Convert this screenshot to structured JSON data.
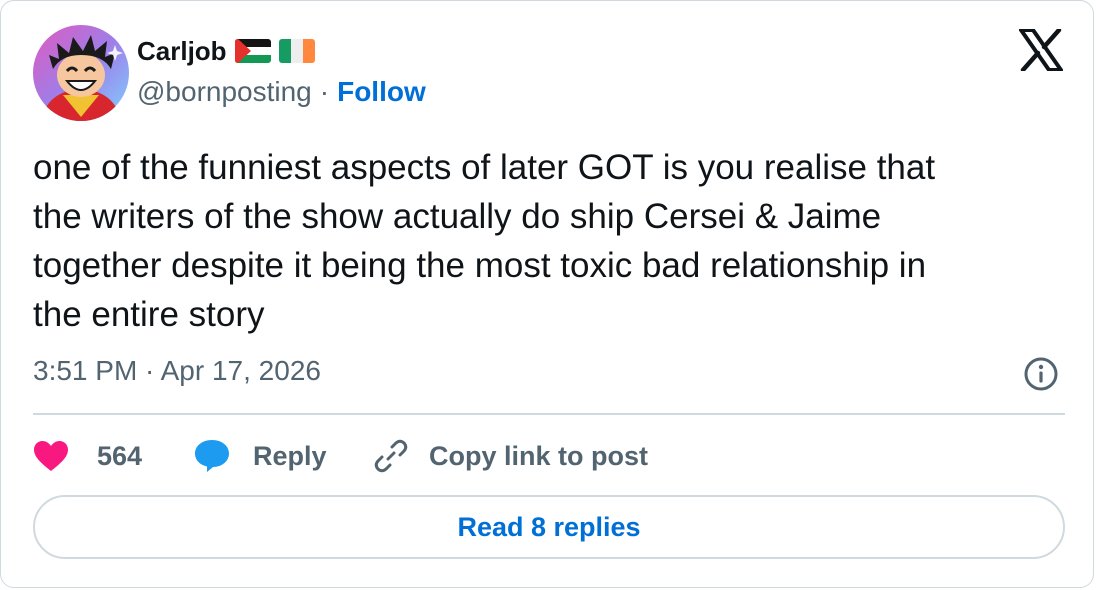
{
  "author": {
    "display_name": "Carljob",
    "handle": "@bornposting",
    "separator": "·",
    "follow_label": "Follow",
    "flags": [
      "palestine-flag",
      "ireland-flag"
    ]
  },
  "tweet": {
    "lines": [
      "one of the funniest aspects of later GOT is you realise that",
      "the writers of the show actually do ship Cersei & Jaime",
      "together despite it being the most toxic bad relationship in",
      "the entire story"
    ],
    "timestamp": "3:51 PM · Apr 17, 2026"
  },
  "actions": {
    "like_count": "564",
    "reply_label": "Reply",
    "copy_link_label": "Copy link to post"
  },
  "footer": {
    "read_replies_label": "Read 8 replies"
  },
  "colors": {
    "text": "#0f1419",
    "secondary": "#536471",
    "link": "#006fd6",
    "like": "#f91880",
    "reply": "#1d9bf0",
    "border": "#cfd9de"
  },
  "icons": {
    "logo": "x-logo-icon",
    "info": "info-icon",
    "like": "heart-icon",
    "reply": "speech-bubble-icon",
    "copy": "link-icon"
  }
}
